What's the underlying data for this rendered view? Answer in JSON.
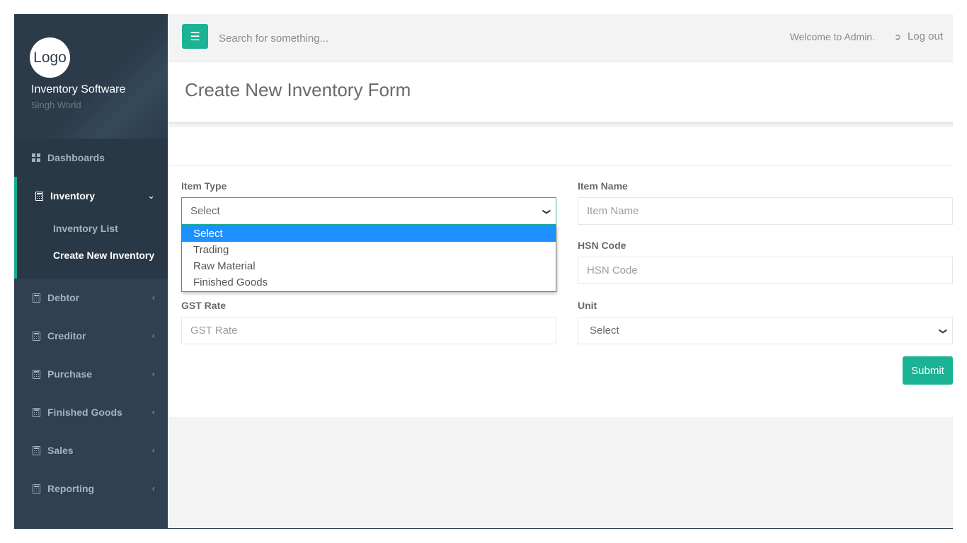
{
  "sidebar": {
    "logo_text": "Logo",
    "app_name": "Inventory Software",
    "app_subtitle": "Singh World",
    "items": [
      {
        "label": "Dashboards",
        "icon": "grid-icon"
      },
      {
        "label": "Inventory",
        "icon": "calculator-icon",
        "expanded": true,
        "children": [
          {
            "label": "Inventory List"
          },
          {
            "label": "Create New Inventory",
            "active": true
          }
        ]
      },
      {
        "label": "Debtor",
        "icon": "calculator-icon"
      },
      {
        "label": "Creditor",
        "icon": "calculator-icon"
      },
      {
        "label": "Purchase",
        "icon": "calculator-icon"
      },
      {
        "label": "Finished Goods",
        "icon": "calculator-icon"
      },
      {
        "label": "Sales",
        "icon": "calculator-icon"
      },
      {
        "label": "Reporting",
        "icon": "calculator-icon"
      }
    ]
  },
  "topbar": {
    "menu_icon": "hamburger-icon",
    "search_placeholder": "Search for something...",
    "welcome_text": "Welcome to Admin.",
    "logout_label": "Log out",
    "logout_icon": "sign-out-icon"
  },
  "page": {
    "title": "Create New Inventory Form"
  },
  "form": {
    "item_type": {
      "label": "Item Type",
      "value": "Select",
      "options": [
        "Select",
        "Trading",
        "Raw Material",
        "Finished Goods"
      ],
      "highlighted_option": "Select"
    },
    "item_name": {
      "label": "Item Name",
      "placeholder": "Item Name"
    },
    "hsn_code": {
      "label": "HSN Code",
      "placeholder": "HSN Code"
    },
    "gst_rate": {
      "label": "GST Rate",
      "placeholder": "GST Rate"
    },
    "unit": {
      "label": "Unit",
      "value": "Select"
    },
    "submit_label": "Submit"
  },
  "colors": {
    "accent": "#1ab394",
    "sidebar_bg": "#2f4050",
    "option_highlight": "#1e90ff"
  }
}
